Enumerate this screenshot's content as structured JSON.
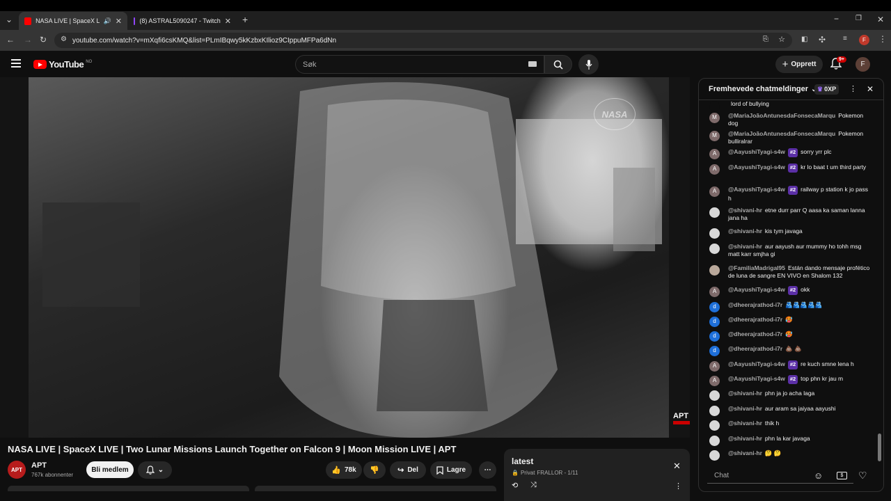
{
  "tabs": [
    {
      "title": "NASA LIVE | SpaceX LIVE | Tv",
      "active": true
    },
    {
      "title": "(8) ASTRAL5090247 - Twitch",
      "active": false
    }
  ],
  "address": {
    "url": "youtube.com/watch?v=mXqfi6csKMQ&list=PLmIBqwy5kKzbxKIlioz9CIppuMFPa6dNn"
  },
  "header": {
    "logo_text": "YouTube",
    "country": "NO",
    "search_placeholder": "Søk",
    "create_label": "Opprett",
    "notif_count": "9+",
    "avatar_letter": "F",
    "profile_letter": "F"
  },
  "video": {
    "watermark": "NASA",
    "channel_logo_overlay": "APT",
    "title": "NASA LIVE | SpaceX LIVE | Two Lunar Missions Launch Together on Falcon 9 | Moon Mission LIVE | APT"
  },
  "channel": {
    "logo_text": "APT",
    "name": "APT",
    "subscribers": "767k abonnenter",
    "join_label": "Bli medlem"
  },
  "actions": {
    "likes": "78k",
    "share": "Del",
    "save": "Lagre"
  },
  "playlist": {
    "title": "latest",
    "privacy": "Privat",
    "owner_progress": "FRALLOR - 1/11"
  },
  "chat": {
    "header": "Fremhevede chatmeldinger",
    "xp": "0XP",
    "input_placeholder": "Chat",
    "messages": [
      {
        "author": "",
        "text": "lord of bullying",
        "badge": "",
        "avatar": "",
        "avatar_color": "#0f0f0f"
      },
      {
        "author": "@MariaJoãoAntunesdaFonsecaMarqu",
        "text": "Pokemon dog",
        "badge": "",
        "avatar": "M",
        "avatar_color": "#7e6a6a"
      },
      {
        "author": "@MariaJoãoAntunesdaFonsecaMarqu",
        "text": "Pokemon bulliralrar",
        "badge": "",
        "avatar": "M",
        "avatar_color": "#7e6a6a"
      },
      {
        "author": "@AayushiTyagi-s4w",
        "text": "sorry yrr plc",
        "badge": "#2",
        "avatar": "A",
        "avatar_color": "#7e6a6a"
      },
      {
        "author": "@AayushiTyagi-s4w",
        "text": "kr lo baat t um third party",
        "badge": "#2",
        "avatar": "A",
        "avatar_color": "#7e6a6a"
      },
      {
        "author": "@AayushiTyagi-s4w",
        "text": "railway p station k jo pass h",
        "badge": "#2",
        "avatar": "A",
        "avatar_color": "#7e6a6a"
      },
      {
        "author": "@shivani-hr",
        "text": "etne durr parr Q aasa ka saman lanna jana ha",
        "badge": "",
        "avatar": "",
        "avatar_color": "#d8d8d8"
      },
      {
        "author": "@shivani-hr",
        "text": "kis tym javaga",
        "badge": "",
        "avatar": "",
        "avatar_color": "#d8d8d8"
      },
      {
        "author": "@shivani-hr",
        "text": "aur aayush aur mummy ho tohh msg matt karr smjha gi",
        "badge": "",
        "avatar": "",
        "avatar_color": "#d8d8d8"
      },
      {
        "author": "@FamiliaMadrigal95",
        "text": "Están dando mensaje profético de luna de sangre EN VIVO en Shalom 132",
        "badge": "",
        "avatar": "",
        "avatar_color": "#b9a89a"
      },
      {
        "author": "@AayushiTyagi-s4w",
        "text": "okk",
        "badge": "#2",
        "avatar": "A",
        "avatar_color": "#7e6a6a"
      },
      {
        "author": "@dheerajrathod-i7r",
        "text": "🫂🫂🫂🫂🫂",
        "badge": "",
        "avatar": "d",
        "avatar_color": "#1e6fd9"
      },
      {
        "author": "@dheerajrathod-i7r",
        "text": "🥵",
        "badge": "",
        "avatar": "d",
        "avatar_color": "#1e6fd9"
      },
      {
        "author": "@dheerajrathod-i7r",
        "text": "🥵",
        "badge": "",
        "avatar": "d",
        "avatar_color": "#1e6fd9"
      },
      {
        "author": "@dheerajrathod-i7r",
        "text": "💩 💩",
        "badge": "",
        "avatar": "d",
        "avatar_color": "#1e6fd9"
      },
      {
        "author": "@AayushiTyagi-s4w",
        "text": "re kuch smne lena h",
        "badge": "#2",
        "avatar": "A",
        "avatar_color": "#7e6a6a"
      },
      {
        "author": "@AayushiTyagi-s4w",
        "text": "top phn kr jau m",
        "badge": "#2",
        "avatar": "A",
        "avatar_color": "#7e6a6a"
      },
      {
        "author": "@shivani-hr",
        "text": "phn ja jo acha laga",
        "badge": "",
        "avatar": "",
        "avatar_color": "#d8d8d8"
      },
      {
        "author": "@shivani-hr",
        "text": "aur aram sa jaiyaa aayushi",
        "badge": "",
        "avatar": "",
        "avatar_color": "#d8d8d8"
      },
      {
        "author": "@shivani-hr",
        "text": "thik h",
        "badge": "",
        "avatar": "",
        "avatar_color": "#d8d8d8"
      },
      {
        "author": "@shivani-hr",
        "text": "phn la kar javaga",
        "badge": "",
        "avatar": "",
        "avatar_color": "#d8d8d8"
      },
      {
        "author": "@shivani-hr",
        "text": "🤔 🤔",
        "badge": "",
        "avatar": "",
        "avatar_color": "#d8d8d8"
      }
    ]
  }
}
